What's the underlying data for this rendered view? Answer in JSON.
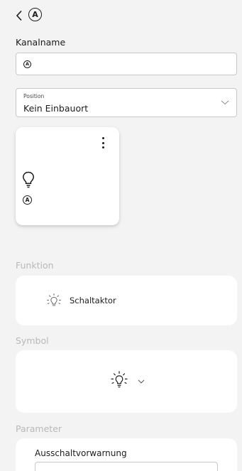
{
  "header": {
    "back_icon": "chevron-left-icon",
    "badge": "A"
  },
  "channel_name": {
    "label": "Kanalname",
    "value_badge": "A"
  },
  "position": {
    "caption": "Position",
    "value": "Kein Einbauort",
    "chevron_icon": "chevron-down-icon"
  },
  "device_card": {
    "menu_icon": "more-vertical-icon",
    "icon": "lightbulb-icon",
    "badge": "A"
  },
  "function": {
    "title": "Funktion",
    "icon": "lightbulb-glow-icon",
    "value": "Schaltaktor"
  },
  "symbol": {
    "title": "Symbol",
    "icon": "lightbulb-glow-icon",
    "chevron_icon": "chevron-down-icon"
  },
  "parameter": {
    "title": "Parameter",
    "label": "Ausschaltvorwarnung"
  }
}
